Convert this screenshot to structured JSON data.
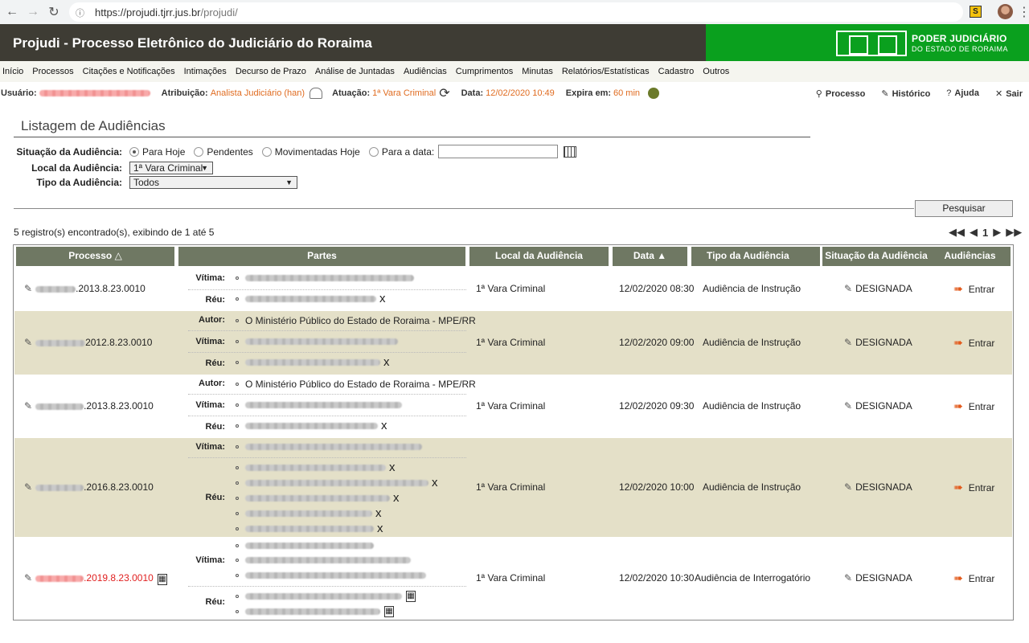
{
  "browser": {
    "url_host": "https://projudi.tjrr.jus.br",
    "url_path": "/projudi/",
    "ext_label": "S"
  },
  "header": {
    "title": "Projudi - Processo Eletrônico do Judiciário do Roraima",
    "brand_line1": "PODER JUDICIÁRIO",
    "brand_line2": "DO ESTADO DE RORAIMA"
  },
  "menu": [
    "Início",
    "Processos",
    "Citações e Notificações",
    "Intimações",
    "Decurso de Prazo",
    "Análise de Juntadas",
    "Audiências",
    "Cumprimentos",
    "Minutas",
    "Relatórios/Estatísticas",
    "Cadastro",
    "Outros"
  ],
  "info": {
    "usuario_label": "Usuário:",
    "atribuicao_label": "Atribuição:",
    "atribuicao_value": "Analista Judiciário (han)",
    "atuacao_label": "Atuação:",
    "atuacao_value": "1ª Vara Criminal",
    "data_label": "Data:",
    "data_value": "12/02/2020 10:49",
    "expira_label": "Expira em:",
    "expira_value": "60 min"
  },
  "top_links": {
    "processo": "Processo",
    "historico": "Histórico",
    "ajuda": "Ajuda",
    "sair": "Sair"
  },
  "page_title": "Listagem de Audiências",
  "filters": {
    "situacao_label": "Situação da Audiência:",
    "situacao_options": [
      "Para Hoje",
      "Pendentes",
      "Movimentadas Hoje",
      "Para a data:"
    ],
    "situacao_selected": "Para Hoje",
    "local_label": "Local da Audiência:",
    "local_value": "1ª Vara Criminal",
    "tipo_label": "Tipo da Audiência:",
    "tipo_value": "Todos",
    "search_button": "Pesquisar"
  },
  "results": {
    "count_text": "5 registro(s) encontrado(s), exibindo de 1 até 5",
    "page": "1"
  },
  "table": {
    "columns": [
      "Processo",
      "Partes",
      "Local da Audiência",
      "Data",
      "Tipo da Audiência",
      "Situação da Audiência",
      "Audiências"
    ],
    "rows": [
      {
        "processo": ".2013.8.23.0010",
        "local": "1ª Vara Criminal",
        "data": "12/02/2020 08:30",
        "tipo": "Audiência de Instrução",
        "situacao": "DESIGNADA",
        "acao": "Entrar"
      },
      {
        "processo": "2012.8.23.0010",
        "local": "1ª Vara Criminal",
        "data": "12/02/2020 09:00",
        "tipo": "Audiência de Instrução",
        "situacao": "DESIGNADA",
        "acao": "Entrar"
      },
      {
        "processo": ".2013.8.23.0010",
        "local": "1ª Vara Criminal",
        "data": "12/02/2020 09:30",
        "tipo": "Audiência de Instrução",
        "situacao": "DESIGNADA",
        "acao": "Entrar"
      },
      {
        "processo": ".2016.8.23.0010",
        "local": "1ª Vara Criminal",
        "data": "12/02/2020 10:00",
        "tipo": "Audiência de Instrução",
        "situacao": "DESIGNADA",
        "acao": "Entrar"
      },
      {
        "processo": ".2019.8.23.0010",
        "local": "1ª Vara Criminal",
        "data": "12/02/2020 10:30",
        "tipo": "Audiência de Interrogatório",
        "situacao": "DESIGNADA",
        "acao": "Entrar"
      }
    ],
    "roles": {
      "vitima": "Vítima:",
      "reu": "Réu:",
      "autor": "Autor:"
    },
    "autor_name": "O Ministério Público do Estado de Roraima - MPE/RR"
  },
  "colors": {
    "header_bg": "#3e3c34",
    "brand_green": "#0aa01e",
    "accent_orange": "#e06c21",
    "th_bg": "#6f7863",
    "row_shaded": "#e4e0c8"
  }
}
